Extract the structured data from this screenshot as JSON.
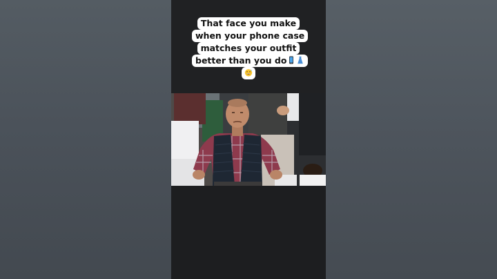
{
  "caption": {
    "lines": [
      "That face you make",
      "when your phone case",
      "matches your outfit",
      "better than you do"
    ],
    "trailing_emojis": [
      "mobile-phone-icon",
      "dress-icon",
      "grinning-sweat-icon"
    ]
  },
  "photo": {
    "subject": "man-with-hands-on-hips"
  },
  "colors": {
    "backdrop": "#4b525a",
    "video_bg": "#1e1f21",
    "caption_bg": "#ffffff",
    "caption_text": "#111111"
  }
}
